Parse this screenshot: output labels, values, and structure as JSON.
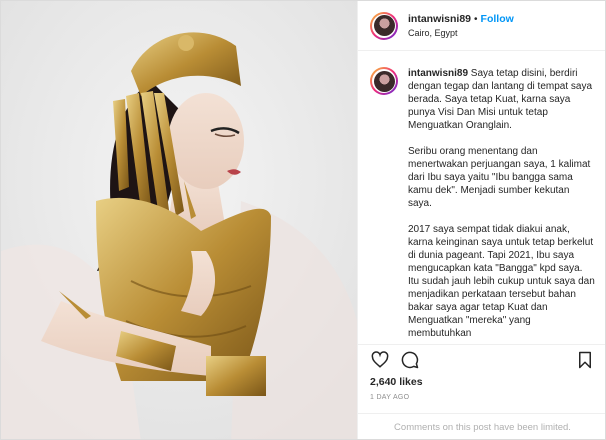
{
  "post": {
    "username": "intanwisni89",
    "separator": "•",
    "follow_label": "Follow",
    "location": "Cairo, Egypt"
  },
  "caption": {
    "username": "intanwisni89",
    "first_line": "Saya tetap disini, berdiri dengan tegap dan lantang di tempat saya berada. Saya tetap Kuat, karna saya punya Visi Dan Misi untuk tetap Menguatkan Oranglain.",
    "para2": "Seribu orang menentang dan menertwakan perjuangan saya, 1 kalimat dari Ibu saya yaitu \"Ibu bangga sama kamu dek\". Menjadi sumber kekutan saya.",
    "para3": "2017 saya sempat tidak diakui anak, karna keinginan saya untuk tetap berkelut di dunia pageant. Tapi 2021, Ibu saya mengucapkan kata \"Bangga\" kpd saya. Itu sudah jauh lebih cukup untuk saya dan menjadikan perkataan tersebut bahan bakar saya agar tetap Kuat dan Menguatkan \"mereka\" yang membutuhkan"
  },
  "stats": {
    "likes": "2,640 likes",
    "time_ago": "1 DAY AGO"
  },
  "comments_notice": "Comments on this post have been limited.",
  "icons": {
    "like": "heart-icon",
    "comment": "comment-icon",
    "save": "bookmark-icon"
  },
  "colors": {
    "follow_blue": "#0095f6",
    "text": "#262626",
    "muted": "#8e8e8e",
    "gold": "#c9a24a"
  }
}
